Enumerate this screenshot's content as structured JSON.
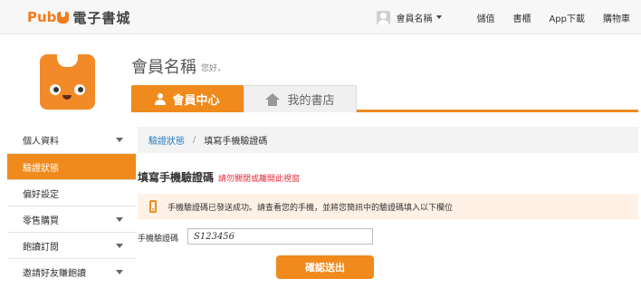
{
  "topbar": {
    "logo_prefix": "Pub",
    "logo_text": "電子書城",
    "user_menu": "會員名稱",
    "nav": [
      "儲值",
      "書櫃",
      "App下載",
      "購物車"
    ]
  },
  "header": {
    "member_name": "會員名稱",
    "greeting": "您好，"
  },
  "tabs": [
    {
      "label": "會員中心",
      "active": true,
      "icon": "person-icon"
    },
    {
      "label": "我的書店",
      "active": false,
      "icon": "home-icon"
    }
  ],
  "sidebar": {
    "items": [
      {
        "label": "個人資料",
        "active": false,
        "expandable": true
      },
      {
        "label": "驗證狀態",
        "active": true,
        "expandable": false
      },
      {
        "label": "偏好設定",
        "active": false,
        "expandable": false
      },
      {
        "label": "零售購買",
        "active": false,
        "expandable": true
      },
      {
        "label": "飽讀訂閱",
        "active": false,
        "expandable": true
      },
      {
        "label": "邀請好友賺飽讀",
        "active": false,
        "expandable": true
      }
    ]
  },
  "breadcrumb": {
    "link": "驗證狀態",
    "separator": "/",
    "current": "填寫手機驗證碼"
  },
  "form": {
    "title": "填寫手機驗證碼",
    "warning": "請勿關閉或離開此視窗",
    "notice": "手機驗證碼已發送成功。請查看您的手機，並將您簡訊中的驗證碼填入以下欄位",
    "field_label": "手機驗證碼",
    "field_value": "S123456",
    "submit_label": "確認送出"
  },
  "colors": {
    "accent": "#f08a1d",
    "link": "#2a7dc0",
    "warning": "#e52b3a",
    "notice_bg": "#fff1e6"
  }
}
